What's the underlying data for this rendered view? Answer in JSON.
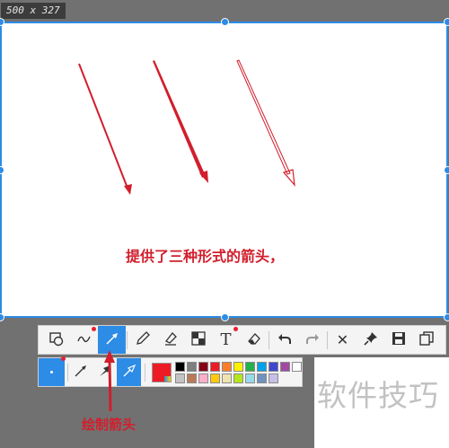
{
  "size_label": "500 x 327",
  "canvas": {
    "caption": "提供了三种形式的箭头，",
    "arrow_color": "#d21e2c"
  },
  "toolbar": {
    "tools": [
      {
        "name": "rectangle-tool",
        "icon": "rectangle-ellipse-icon"
      },
      {
        "name": "freehand-tool",
        "icon": "freehand-icon",
        "badge": true
      },
      {
        "name": "arrow-tool",
        "icon": "arrow-icon",
        "active": true
      },
      {
        "name": "pencil-tool",
        "icon": "pencil-icon"
      },
      {
        "name": "highlighter-tool",
        "icon": "highlighter-icon"
      },
      {
        "name": "mosaic-tool",
        "icon": "mosaic-icon"
      },
      {
        "name": "text-tool",
        "icon": "text-icon",
        "badge": true
      },
      {
        "name": "eraser-tool",
        "icon": "eraser-icon"
      },
      {
        "name": "undo-button",
        "icon": "undo-icon"
      },
      {
        "name": "redo-button",
        "icon": "redo-icon"
      },
      {
        "name": "close-button",
        "icon": "close-icon"
      },
      {
        "name": "pin-button",
        "icon": "pin-icon"
      },
      {
        "name": "save-button",
        "icon": "save-icon"
      },
      {
        "name": "copy-button",
        "icon": "copy-icon"
      }
    ],
    "text_glyph": "T",
    "close_glyph": "✕"
  },
  "subbar": {
    "arrow_styles": [
      "thin-arrow-icon",
      "solid-arrow-icon",
      "hollow-arrow-icon"
    ],
    "selected_style": 2,
    "current_color": "#ed1c24",
    "palette": [
      "#000000",
      "#7f7f7f",
      "#880015",
      "#ed1c24",
      "#ff7f27",
      "#fff200",
      "#22b14c",
      "#00a2e8",
      "#3f48cc",
      "#a349a4",
      "#ffffff",
      "#c3c3c3",
      "#b97a57",
      "#ffaec9",
      "#ffc90e",
      "#efe4b0",
      "#b5e61d",
      "#99d9ea",
      "#7092be",
      "#c8bfe7"
    ]
  },
  "annotation": {
    "label": "绘制箭头"
  },
  "watermark": {
    "text": "软件技巧"
  }
}
